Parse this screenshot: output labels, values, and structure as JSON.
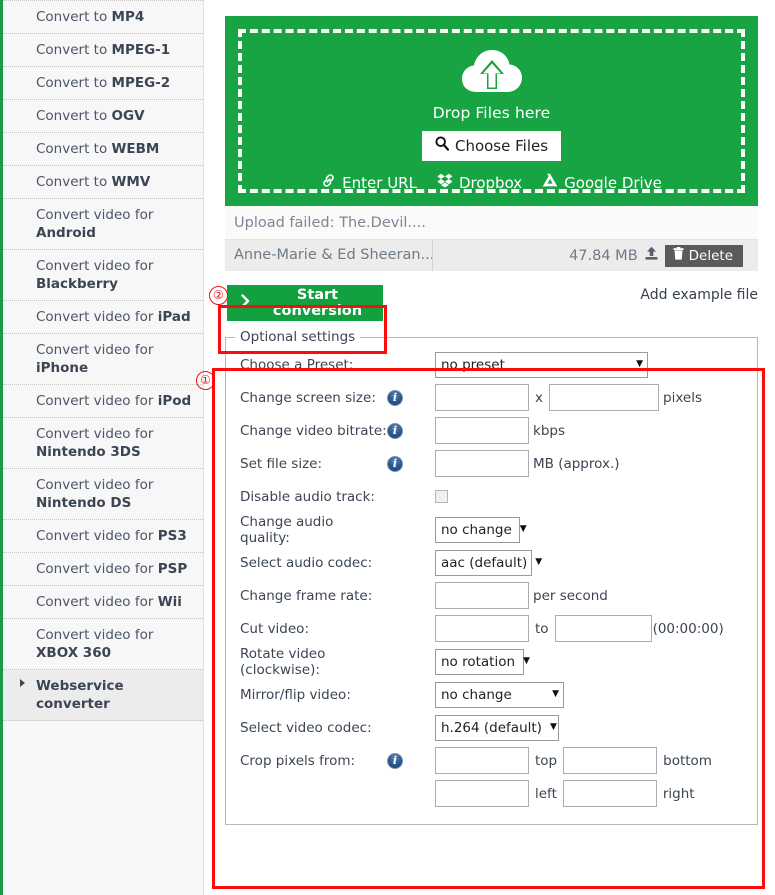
{
  "sidebar": {
    "items": [
      {
        "prefix": "Convert to ",
        "strong": "MP4"
      },
      {
        "prefix": "Convert to ",
        "strong": "MPEG-1"
      },
      {
        "prefix": "Convert to ",
        "strong": "MPEG-2"
      },
      {
        "prefix": "Convert to ",
        "strong": "OGV"
      },
      {
        "prefix": "Convert to ",
        "strong": "WEBM"
      },
      {
        "prefix": "Convert to ",
        "strong": "WMV"
      },
      {
        "prefix": "Convert video for ",
        "strong": "Android"
      },
      {
        "prefix": "Convert video for ",
        "strong": "Blackberry"
      },
      {
        "prefix": "Convert video for ",
        "strong": "iPad"
      },
      {
        "prefix": "Convert video for ",
        "strong": "iPhone"
      },
      {
        "prefix": "Convert video for ",
        "strong": "iPod"
      },
      {
        "prefix": "Convert video for ",
        "strong": "Nintendo 3DS"
      },
      {
        "prefix": "Convert video for ",
        "strong": "Nintendo DS"
      },
      {
        "prefix": "Convert video for ",
        "strong": "PS3"
      },
      {
        "prefix": "Convert video for ",
        "strong": "PSP"
      },
      {
        "prefix": "Convert video for ",
        "strong": "Wii"
      },
      {
        "prefix": "Convert video for ",
        "strong": "XBOX 360"
      }
    ],
    "webservice_label": "Webservice converter"
  },
  "dropzone": {
    "drop_label": "Drop Files here",
    "choose_files_label": "Choose Files",
    "enter_url_label": "Enter URL",
    "dropbox_label": "Dropbox",
    "google_drive_label": "Google Drive",
    "bg_color": "#18a443"
  },
  "files": {
    "upload_status": "Upload failed: The.Devil....",
    "row": {
      "name": "Anne-Marie & Ed Sheeran...",
      "size": "47.84 MB",
      "delete_label": "Delete"
    }
  },
  "actions": {
    "start_conversion_label": "Start conversion",
    "add_example_label": "Add example file"
  },
  "optional_settings": {
    "legend": "Optional settings",
    "rows": {
      "preset": {
        "label": "Choose a Preset:",
        "value": "no preset"
      },
      "screen_size": {
        "label": "Change screen size:",
        "value_w": "",
        "value_h": "",
        "sep": "x",
        "unit": "pixels"
      },
      "video_bitrate": {
        "label": "Change video bitrate:",
        "value": "",
        "unit": "kbps"
      },
      "file_size": {
        "label": "Set file size:",
        "value": "",
        "unit": "MB (approx.)"
      },
      "disable_audio": {
        "label": "Disable audio track:",
        "checked": false
      },
      "audio_quality": {
        "label": "Change audio quality:",
        "value": "no change"
      },
      "audio_codec": {
        "label": "Select audio codec:",
        "value": "aac (default)"
      },
      "frame_rate": {
        "label": "Change frame rate:",
        "value": "",
        "unit": "per second"
      },
      "cut_video": {
        "label": "Cut video:",
        "value_from": "",
        "value_to": "",
        "sep": "to",
        "unit": "(00:00:00)"
      },
      "rotate": {
        "label": "Rotate video (clockwise):",
        "value": "no rotation"
      },
      "mirror": {
        "label": "Mirror/flip video:",
        "value": "no change"
      },
      "video_codec": {
        "label": "Select video codec:",
        "value": "h.264 (default)"
      },
      "crop": {
        "label": "Crop pixels from:",
        "top_value": "",
        "top_unit": "top",
        "bottom_value": "",
        "bottom_unit": "bottom",
        "left_value": "",
        "left_unit": "left",
        "right_value": "",
        "right_unit": "right"
      }
    }
  },
  "annotations": {
    "marker_one": "①",
    "marker_two": "②",
    "color": "#fb0d0d"
  }
}
